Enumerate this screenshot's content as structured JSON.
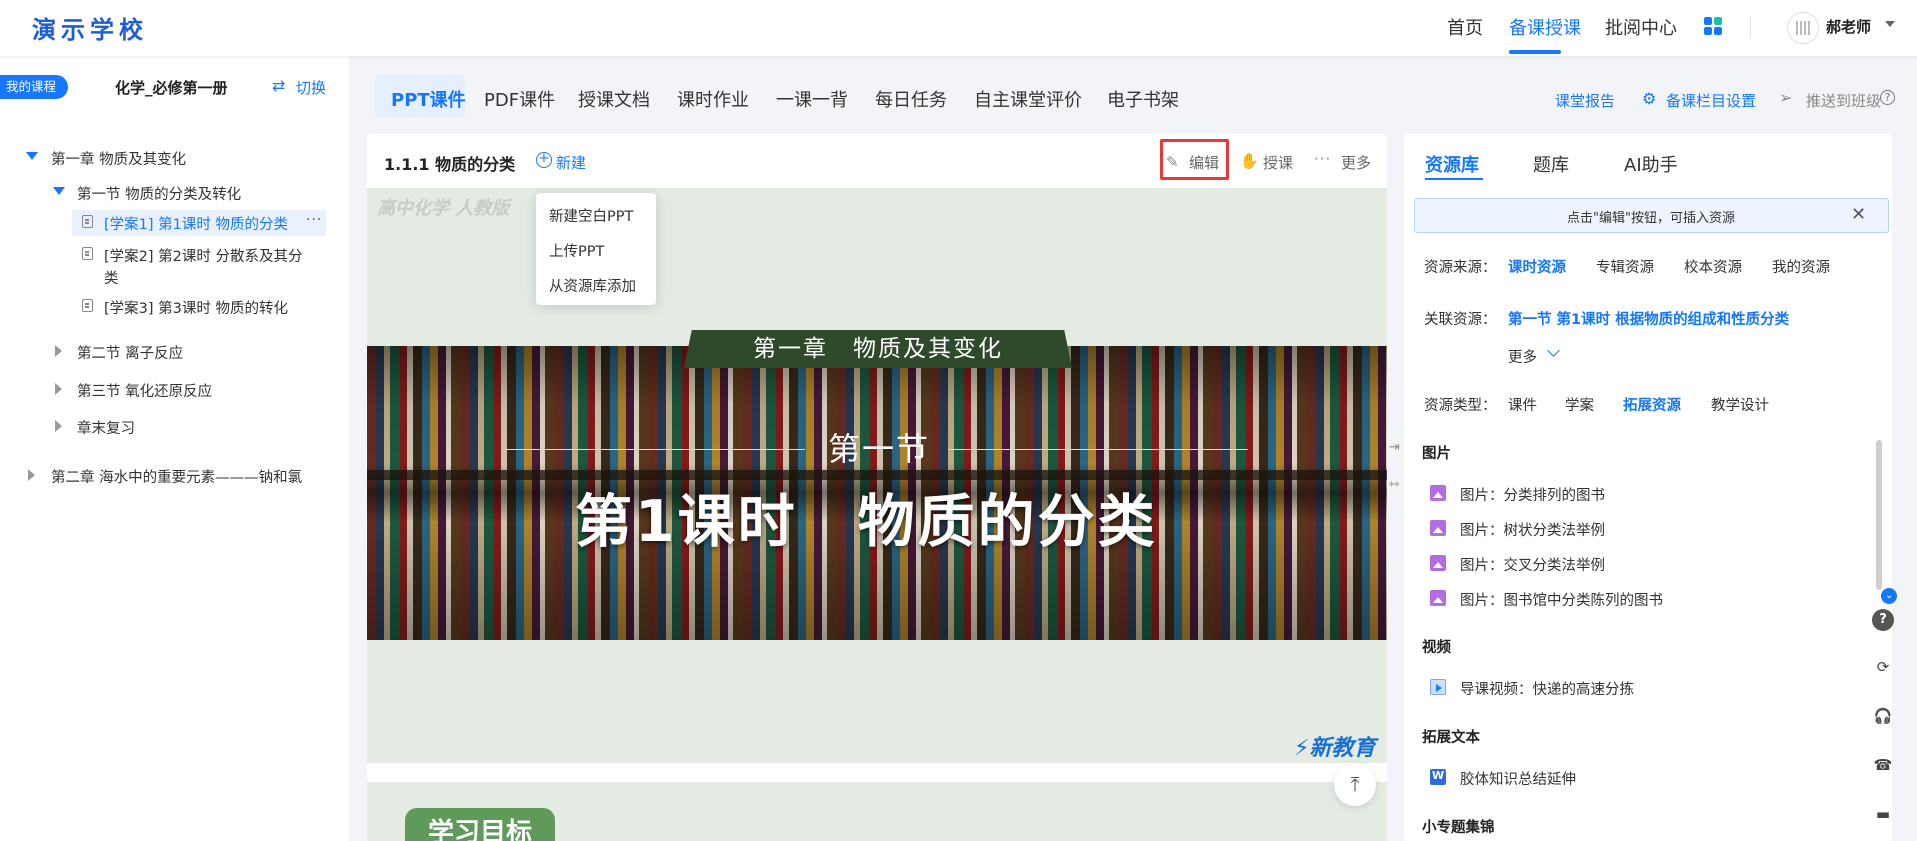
{
  "header": {
    "school": "演示学校",
    "nav": [
      "首页",
      "备课授课",
      "批阅中心"
    ],
    "active_nav": "备课授课",
    "user_name": "郝老师"
  },
  "sidebar": {
    "my_course": "我的课程",
    "course_name": "化学_必修第一册",
    "switch": "切换",
    "tree": {
      "ch1": "第一章 物质及其变化",
      "sec1": "第一节 物质的分类及转化",
      "lesson1": "[学案1] 第1课时 物质的分类",
      "lesson1_more": "···",
      "lesson2_line1": "[学案2] 第2课时 分散系及其分",
      "lesson2_line2": "类",
      "lesson3": "[学案3] 第3课时 物质的转化",
      "sec2": "第二节 离子反应",
      "sec3": "第三节 氧化还原反应",
      "review": "章末复习",
      "ch2": "第二章 海水中的重要元素———钠和氯"
    }
  },
  "tabs": [
    "PPT课件",
    "PDF课件",
    "授课文档",
    "课时作业",
    "一课一背",
    "每日任务",
    "自主课堂评价",
    "电子书架"
  ],
  "toolbar_right": {
    "report": "课堂报告",
    "settings": "备课栏目设置",
    "push": "推送到班级",
    "help": "?"
  },
  "panel": {
    "title": "1.1.1 物质的分类",
    "new_label": "新建",
    "edit_label": "编辑",
    "teach_label": "授课",
    "more_label": "更多",
    "dropdown": [
      "新建空白PPT",
      "上传PPT",
      "从资源库添加"
    ]
  },
  "slide": {
    "watermark": "高中化学 人教版",
    "chapter": "第一章　物质及其变化",
    "section": "第一节",
    "lesson": "第1课时　物质的分类",
    "brand": "新教育",
    "next_slide_tag": "学习目标"
  },
  "resource_panel": {
    "tabs": [
      "资源库",
      "题库",
      "AI助手"
    ],
    "notice": "点击\"编辑\"按钮，可插入资源",
    "source_label": "资源来源：",
    "sources": [
      "课时资源",
      "专辑资源",
      "校本资源",
      "我的资源"
    ],
    "related_label": "关联资源：",
    "related_value": "第一节 第1课时 根据物质的组成和性质分类",
    "more": "更多",
    "type_label": "资源类型：",
    "types": [
      "课件",
      "学案",
      "拓展资源",
      "教学设计"
    ],
    "categories": {
      "images": "图片",
      "video": "视频",
      "text": "拓展文本",
      "topics": "小专题集锦"
    },
    "image_items": [
      "图片：分类排列的图书",
      "图片：树状分类法举例",
      "图片：交叉分类法举例",
      "图片：图书馆中分类陈列的图书"
    ],
    "video_items": [
      "导课视频：快递的高速分拣"
    ],
    "text_items": [
      "胶体知识总结延伸"
    ]
  },
  "colors": {
    "accent": "#1677ff",
    "highlight_box": "#e53935"
  }
}
